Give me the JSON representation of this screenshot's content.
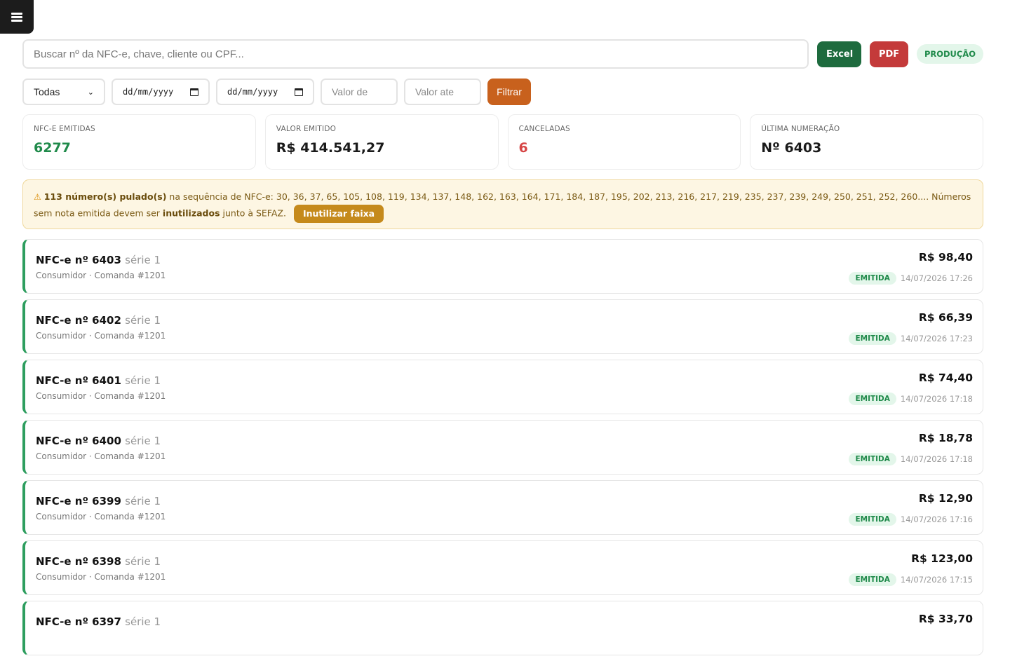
{
  "toolbar": {
    "search_placeholder": "Buscar nº da NFC-e, chave, cliente ou CPF...",
    "excel_label": "Excel",
    "pdf_label": "PDF",
    "env_badge": "PRODUÇÃO"
  },
  "filters": {
    "status_selected": "Todas",
    "date_from": "dd/mm/yyyy",
    "date_to": "dd/mm/yyyy",
    "value_from_placeholder": "Valor de",
    "value_to_placeholder": "Valor ate",
    "filter_label": "Filtrar"
  },
  "stats": [
    {
      "label": "NFC-e emitidas",
      "value": "6277"
    },
    {
      "label": "Valor emitido",
      "value": "R$ 414.541,27"
    },
    {
      "label": "Canceladas",
      "value": "6"
    },
    {
      "label": "Última numeração",
      "value": "Nº 6403"
    }
  ],
  "alert": {
    "icon": "⚠",
    "count_text": "113 número(s) pulado(s)",
    "sequence_text": " na sequência de NFC-e: 30, 36, 37, 65, 105, 108, 119, 134, 137, 148, 162, 163, 164, 171, 184, 187, 195, 202, 213, 216, 217, 219, 235, 237, 239, 249, 250, 251, 252, 260.... Números sem nota emitida devem ser ",
    "bold_word": "inutilizados",
    "tail_text": " junto à SEFAZ.",
    "button_label": "Inutilizar faixa"
  },
  "notes": [
    {
      "prefix": "NFC-e nº",
      "number": "6403",
      "serie": "série 1",
      "subtitle": "Consumidor · Comanda #1201",
      "amount": "R$ 98,40",
      "status": "EMITIDA",
      "datetime": "14/07/2026 17:26"
    },
    {
      "prefix": "NFC-e nº",
      "number": "6402",
      "serie": "série 1",
      "subtitle": "Consumidor · Comanda #1201",
      "amount": "R$ 66,39",
      "status": "EMITIDA",
      "datetime": "14/07/2026 17:23"
    },
    {
      "prefix": "NFC-e nº",
      "number": "6401",
      "serie": "série 1",
      "subtitle": "Consumidor · Comanda #1201",
      "amount": "R$ 74,40",
      "status": "EMITIDA",
      "datetime": "14/07/2026 17:18"
    },
    {
      "prefix": "NFC-e nº",
      "number": "6400",
      "serie": "série 1",
      "subtitle": "Consumidor · Comanda #1201",
      "amount": "R$ 18,78",
      "status": "EMITIDA",
      "datetime": "14/07/2026 17:18"
    },
    {
      "prefix": "NFC-e nº",
      "number": "6399",
      "serie": "série 1",
      "subtitle": "Consumidor · Comanda #1201",
      "amount": "R$ 12,90",
      "status": "EMITIDA",
      "datetime": "14/07/2026 17:16"
    },
    {
      "prefix": "NFC-e nº",
      "number": "6398",
      "serie": "série 1",
      "subtitle": "Consumidor · Comanda #1201",
      "amount": "R$ 123,00",
      "status": "EMITIDA",
      "datetime": "14/07/2026 17:15"
    },
    {
      "prefix": "NFC-e nº",
      "number": "6397",
      "serie": "série 1",
      "subtitle": "",
      "amount": "R$ 33,70",
      "status": "",
      "datetime": ""
    }
  ]
}
